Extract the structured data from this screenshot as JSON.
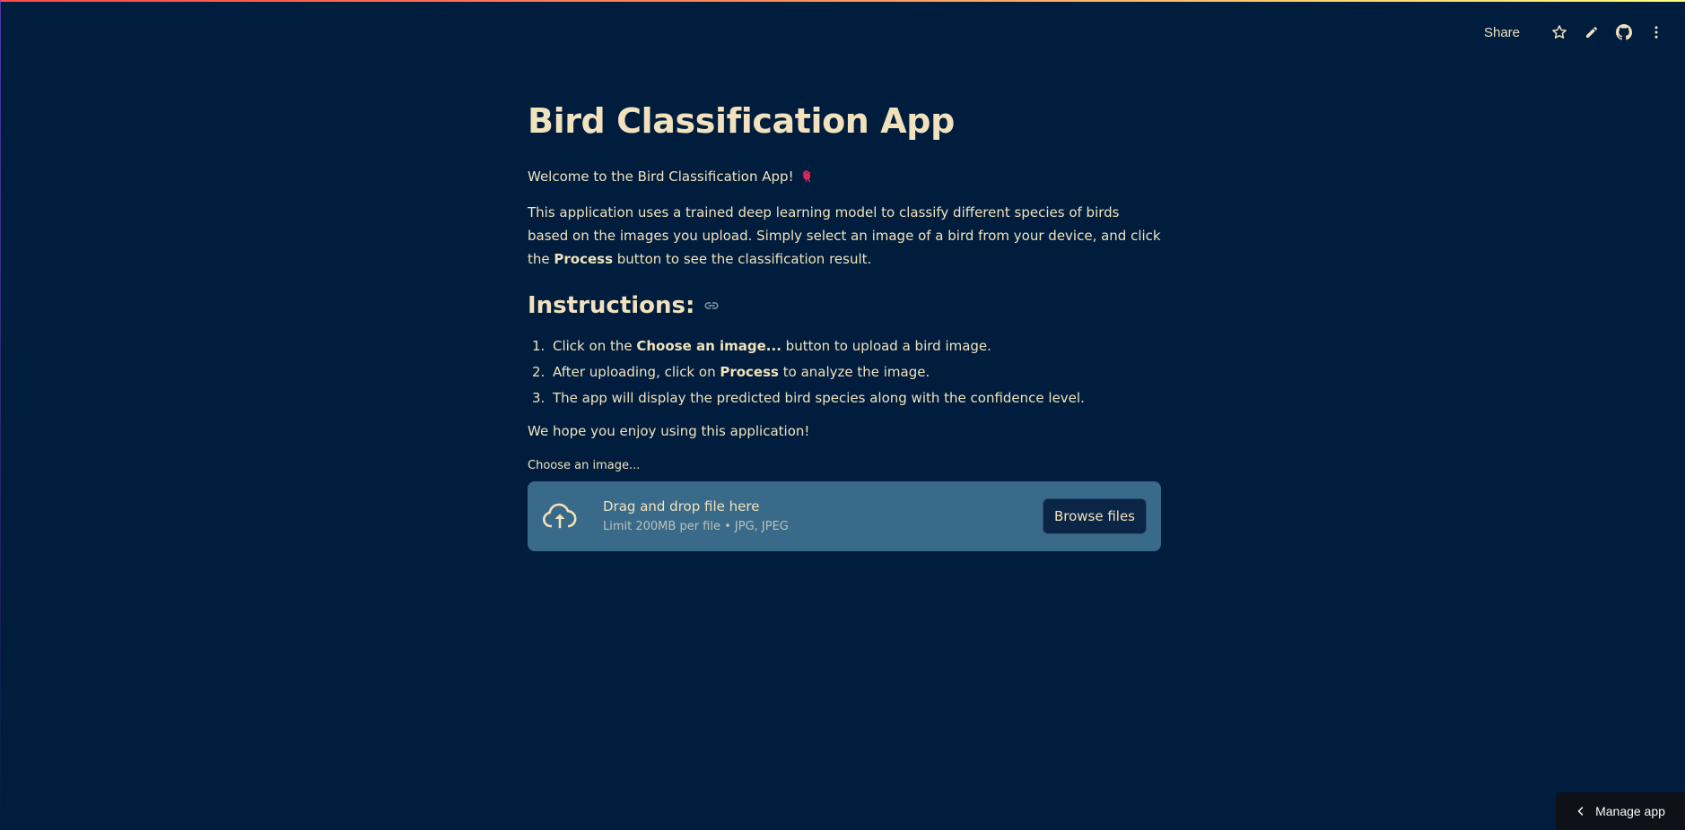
{
  "toolbar": {
    "share_label": "Share",
    "icons": [
      "star-icon",
      "pencil-icon",
      "github-icon",
      "kebab-menu-icon"
    ]
  },
  "main": {
    "title": "Bird Classification App",
    "welcome": "Welcome to the Bird Classification App!",
    "about": {
      "part1": "This application uses a trained deep learning model to classify different species of birds based on the images you upload. Simply select an image of a bird from your device, and click the ",
      "bold": "Process",
      "part2": " button to see the classification result."
    },
    "instructions_heading": "Instructions:",
    "instructions": [
      {
        "num": "1.",
        "pre": "Click on the ",
        "bold": "Choose an image...",
        "post": " button to upload a bird image."
      },
      {
        "num": "2.",
        "pre": "After uploading, click on ",
        "bold": "Process",
        "post": " to analyze the image."
      },
      {
        "num": "3.",
        "pre": "The app will display the predicted bird species along with the confidence level.",
        "bold": "",
        "post": ""
      }
    ],
    "outro": "We hope you enjoy using this application!"
  },
  "uploader": {
    "label": "Choose an image...",
    "drag_text": "Drag and drop file here",
    "limit_text": "Limit 200MB per file • JPG, JPEG",
    "browse_label": "Browse files"
  },
  "manage_app": {
    "label": "Manage app"
  },
  "colors": {
    "background": "#001d3d",
    "text": "#f1e2bd",
    "dropzone": "#3a6a8a",
    "browse_button": "#0b2547"
  }
}
